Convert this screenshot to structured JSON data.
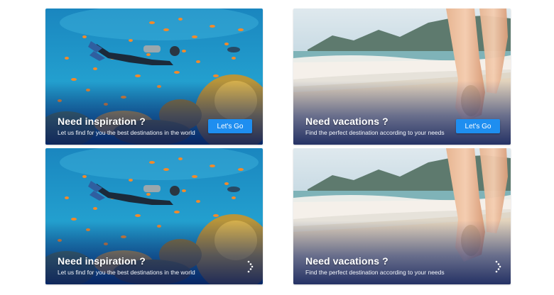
{
  "cards": [
    {
      "title": "Need inspiration ?",
      "subtitle": "Let us find for you the best destinations in the world",
      "button_label": "Let's Go",
      "image": "scuba-diver-coral-reef"
    },
    {
      "title": "Need vacations ?",
      "subtitle": "Find the perfect destination according to your needs",
      "button_label": "Let's Go",
      "image": "feet-walking-on-beach"
    },
    {
      "title": "Need inspiration ?",
      "subtitle": "Let us find for you the best destinations in the world",
      "action_icon": "more-dots-icon",
      "image": "scuba-diver-coral-reef"
    },
    {
      "title": "Need vacations ?",
      "subtitle": "Find the perfect destination according to your needs",
      "action_icon": "more-dots-icon",
      "image": "feet-walking-on-beach"
    }
  ],
  "colors": {
    "button": "#1e8ef0",
    "overlay": "#0a236e",
    "water": "#1c8fc4",
    "sand": "#e8d9c2"
  }
}
